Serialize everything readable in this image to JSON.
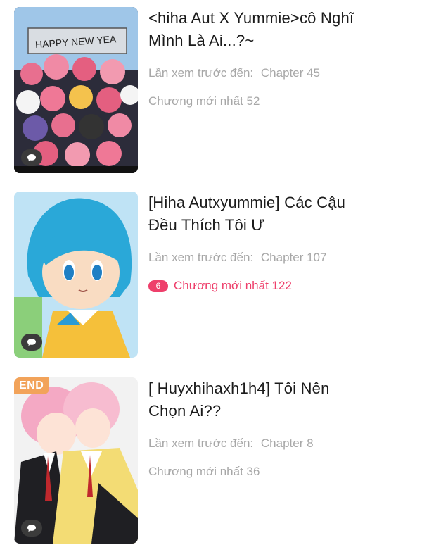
{
  "items": [
    {
      "title_line1": "<hiha Aut X Yummie>cô Nghĩ",
      "title_line2": "Mình Là Ai...?~",
      "last_viewed_label": "Lần xem trước đến:",
      "last_viewed_value": "Chapter 45",
      "latest_label": "Chương mới nhất",
      "latest_value": "52",
      "cover_text": "HAPPY NEW YEA"
    },
    {
      "title_line1": "[Hiha Autxyummie] Các Cậu",
      "title_line2": "Đều Thích Tôi Ư",
      "last_viewed_label": "Lần xem trước đến:",
      "last_viewed_value": "Chapter 107",
      "latest_label": "Chương mới nhất",
      "latest_value": "122",
      "new_count": "6"
    },
    {
      "title_line1": "[ Huyxhihaxh1h4] Tôi Nên",
      "title_line2": "Chọn Ai??",
      "last_viewed_label": "Lần xem trước đến:",
      "last_viewed_value": "Chapter 8",
      "latest_label": "Chương mới nhất",
      "latest_value": "36",
      "status_tag": "END"
    }
  ],
  "colors": {
    "accent": "#ee3f6b",
    "muted": "#a7a7a7",
    "end_tag": "#f2a35a"
  },
  "icons": {
    "comment": "chat-bubble-icon"
  }
}
